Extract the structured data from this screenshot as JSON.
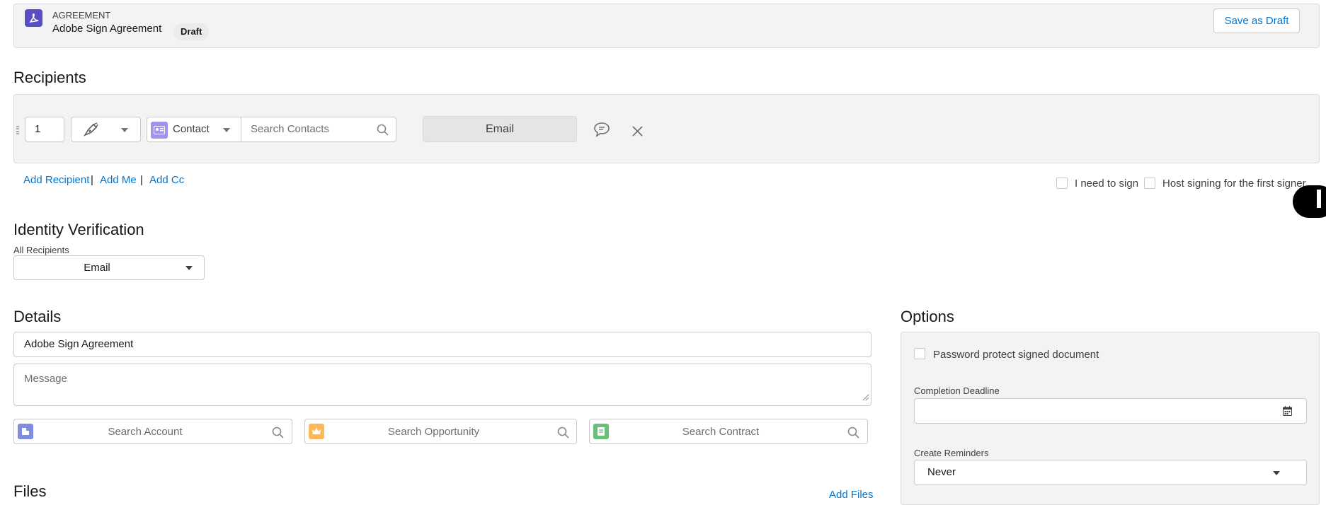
{
  "header": {
    "object_type": "AGREEMENT",
    "title": "Adobe Sign Agreement",
    "status_badge": "Draft",
    "save_as_draft_label": "Save as Draft",
    "logo_icon": "adobe-acrobat-icon",
    "accent_color": "#5a4ec6"
  },
  "recipients": {
    "section_title": "Recipients",
    "rows": [
      {
        "order": "1",
        "role_icon": "pen-signer-icon",
        "type_label": "Contact",
        "search_placeholder": "Search Contacts",
        "delivery_label": "Email"
      }
    ],
    "add_recipient_label": "Add Recipient",
    "add_me_label": "Add Me",
    "add_cc_label": "Add Cc",
    "i_need_to_sign_label": "I need to sign",
    "host_signing_label": "Host signing for the first signer"
  },
  "identity_verification": {
    "section_title": "Identity Verification",
    "scope_label": "All Recipients",
    "selected_method": "Email"
  },
  "details": {
    "section_title": "Details",
    "agreement_name": "Adobe Sign Agreement",
    "message_placeholder": "Message",
    "search_account_placeholder": "Search Account",
    "search_opportunity_placeholder": "Search Opportunity",
    "search_contract_placeholder": "Search Contract"
  },
  "files": {
    "section_title": "Files",
    "add_files_label": "Add Files"
  },
  "options": {
    "section_title": "Options",
    "password_protect_label": "Password protect signed document",
    "completion_deadline_label": "Completion Deadline",
    "completion_deadline_value": "",
    "create_reminders_label": "Create Reminders",
    "create_reminders_value": "Never"
  },
  "colors": {
    "link": "#0176d3",
    "panel_bg": "#f3f3f3",
    "account_icon": "#7f8de1",
    "opportunity_icon": "#fcb95b",
    "contract_icon": "#6cbf7a"
  }
}
